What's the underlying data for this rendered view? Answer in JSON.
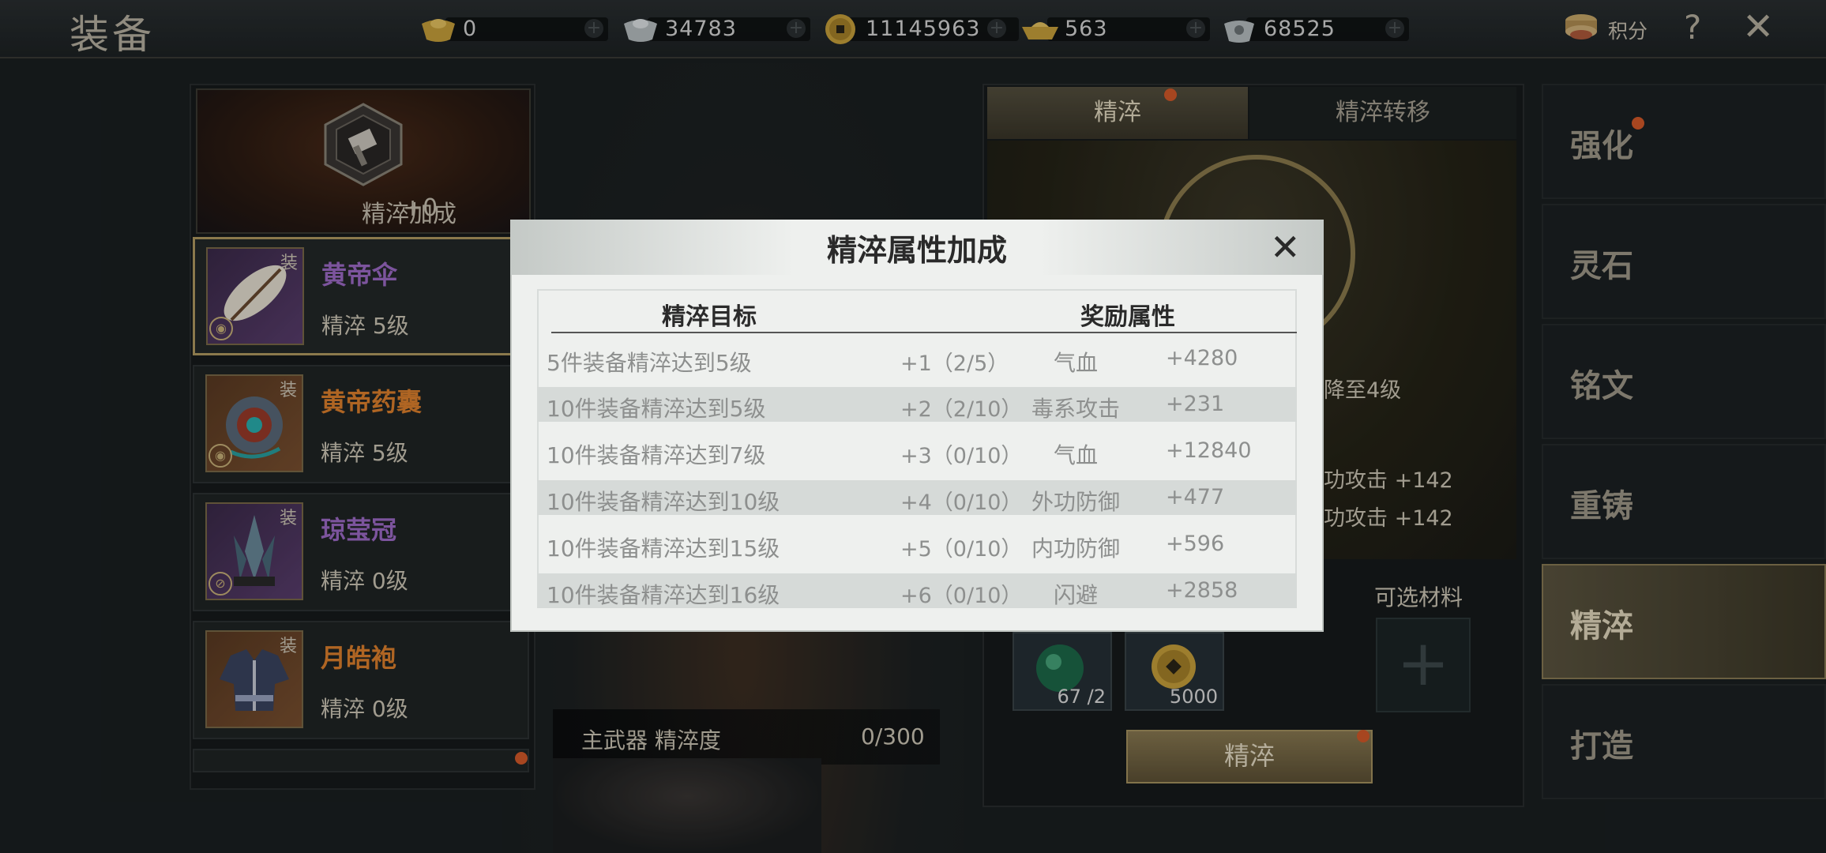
{
  "header": {
    "title": "装备",
    "currencies": [
      {
        "icon": "gold-ingot-icon",
        "value": "0"
      },
      {
        "icon": "silver-ingot-icon",
        "value": "34783"
      },
      {
        "icon": "copper-coin-icon",
        "value": "11145963"
      },
      {
        "icon": "gold-boat-icon",
        "value": "563"
      },
      {
        "icon": "silver-pot-icon",
        "value": "68525"
      }
    ],
    "jifen_label": "积分",
    "help": "?",
    "close": "✕"
  },
  "bonus": {
    "label": "精淬加成",
    "value": "+0"
  },
  "equipment": [
    {
      "tag": "装",
      "name": "黄帝伞",
      "level": "精淬 5级",
      "name_color": "#9f6cc9"
    },
    {
      "tag": "装",
      "name": "黄帝药囊",
      "level": "精淬 5级",
      "name_color": "#e0822e"
    },
    {
      "tag": "装",
      "name": "琼莹冠",
      "level": "精淬 0级",
      "name_color": "#9f6cc9"
    },
    {
      "tag": "装",
      "name": "月皓袍",
      "level": "精淬 0级",
      "name_color": "#e0822e"
    }
  ],
  "progress": {
    "label": "主武器 精淬度",
    "value": "0/300"
  },
  "refine_panel": {
    "tabs": [
      "精淬",
      "精淬转移"
    ],
    "stat_lines": [
      "降至4级",
      "功攻击 +142",
      "功攻击 +142"
    ],
    "optional_label": "可选材料",
    "materials": [
      {
        "icon": "jade-orb-icon",
        "count": "67 /2"
      },
      {
        "icon": "copper-coin-icon",
        "count": "5000"
      }
    ],
    "button": "精淬"
  },
  "side_menu": [
    "强化",
    "灵石",
    "铭文",
    "重铸",
    "精淬",
    "打造"
  ],
  "modal": {
    "title": "精淬属性加成",
    "close": "✕",
    "col_target": "精淬目标",
    "col_reward": "奖励属性",
    "rows": [
      {
        "target": "5件装备精淬达到5级",
        "progress": "+1（2/5）",
        "attr": "气血",
        "value": "+4280"
      },
      {
        "target": "10件装备精淬达到5级",
        "progress": "+2（2/10）",
        "attr": "毒系攻击",
        "value": "+231"
      },
      {
        "target": "10件装备精淬达到7级",
        "progress": "+3（0/10）",
        "attr": "气血",
        "value": "+12840"
      },
      {
        "target": "10件装备精淬达到10级",
        "progress": "+4（0/10）",
        "attr": "外功防御",
        "value": "+477"
      },
      {
        "target": "10件装备精淬达到15级",
        "progress": "+5（0/10）",
        "attr": "内功防御",
        "value": "+596"
      },
      {
        "target": "10件装备精淬达到16级",
        "progress": "+6（0/10）",
        "attr": "闪避",
        "value": "+2858"
      }
    ]
  }
}
